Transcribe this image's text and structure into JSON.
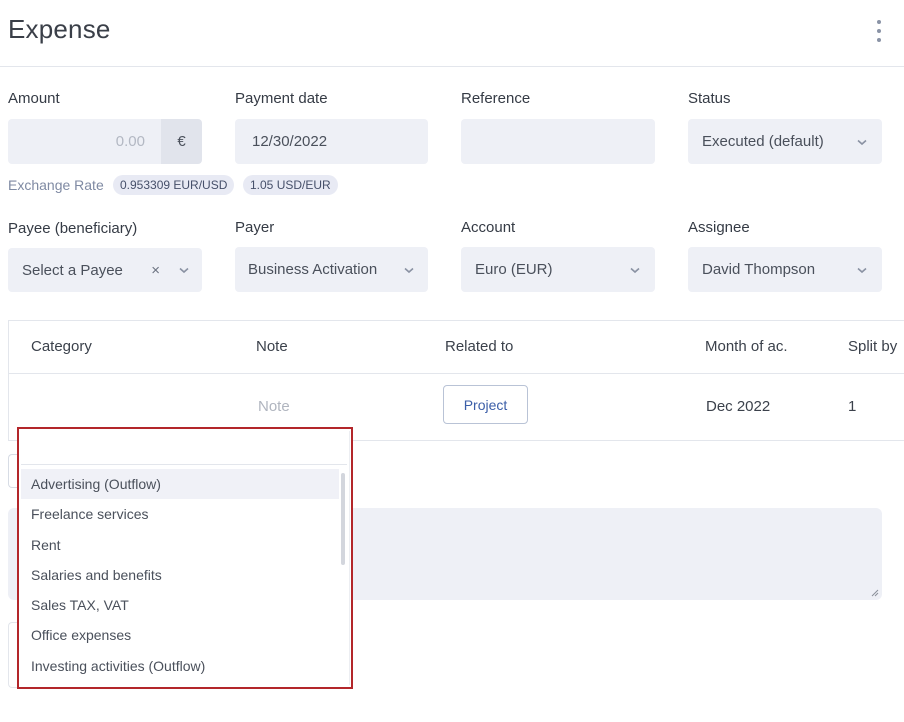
{
  "header": {
    "title": "Expense"
  },
  "fields": {
    "amount": {
      "label": "Amount",
      "placeholder": "0.00",
      "currency_symbol": "€"
    },
    "payment_date": {
      "label": "Payment date",
      "value": "12/30/2022"
    },
    "reference": {
      "label": "Reference",
      "value": ""
    },
    "status": {
      "label": "Status",
      "value": "Executed (default)"
    },
    "exchange": {
      "label": "Exchange Rate",
      "rate1": "0.953309 EUR/USD",
      "rate2": "1.05 USD/EUR"
    },
    "payee": {
      "label": "Payee (beneficiary)",
      "placeholder": "Select a Payee",
      "clear": "×"
    },
    "payer": {
      "label": "Payer",
      "value": "Business Activation"
    },
    "account": {
      "label": "Account",
      "value": "Euro (EUR)"
    },
    "assignee": {
      "label": "Assignee",
      "value": "David Thompson"
    }
  },
  "table": {
    "headers": [
      "Category",
      "Note",
      "Related to",
      "Month of ac.",
      "Split by"
    ],
    "row": {
      "note_placeholder": "Note",
      "related_button": "Project",
      "month": "Dec 2022",
      "split": "1"
    }
  },
  "category_dropdown": {
    "search_value": "",
    "options": [
      "Advertising (Outflow)",
      "Freelance services",
      "Rent",
      "Salaries and benefits",
      "Sales TAX, VAT",
      "Office expenses",
      "Investing activities (Outflow)"
    ],
    "highlighted_index": 0
  },
  "colors": {
    "accent": "#3b5ea8",
    "field_bg": "#eef0f6",
    "focus_outline": "#b3262a"
  }
}
